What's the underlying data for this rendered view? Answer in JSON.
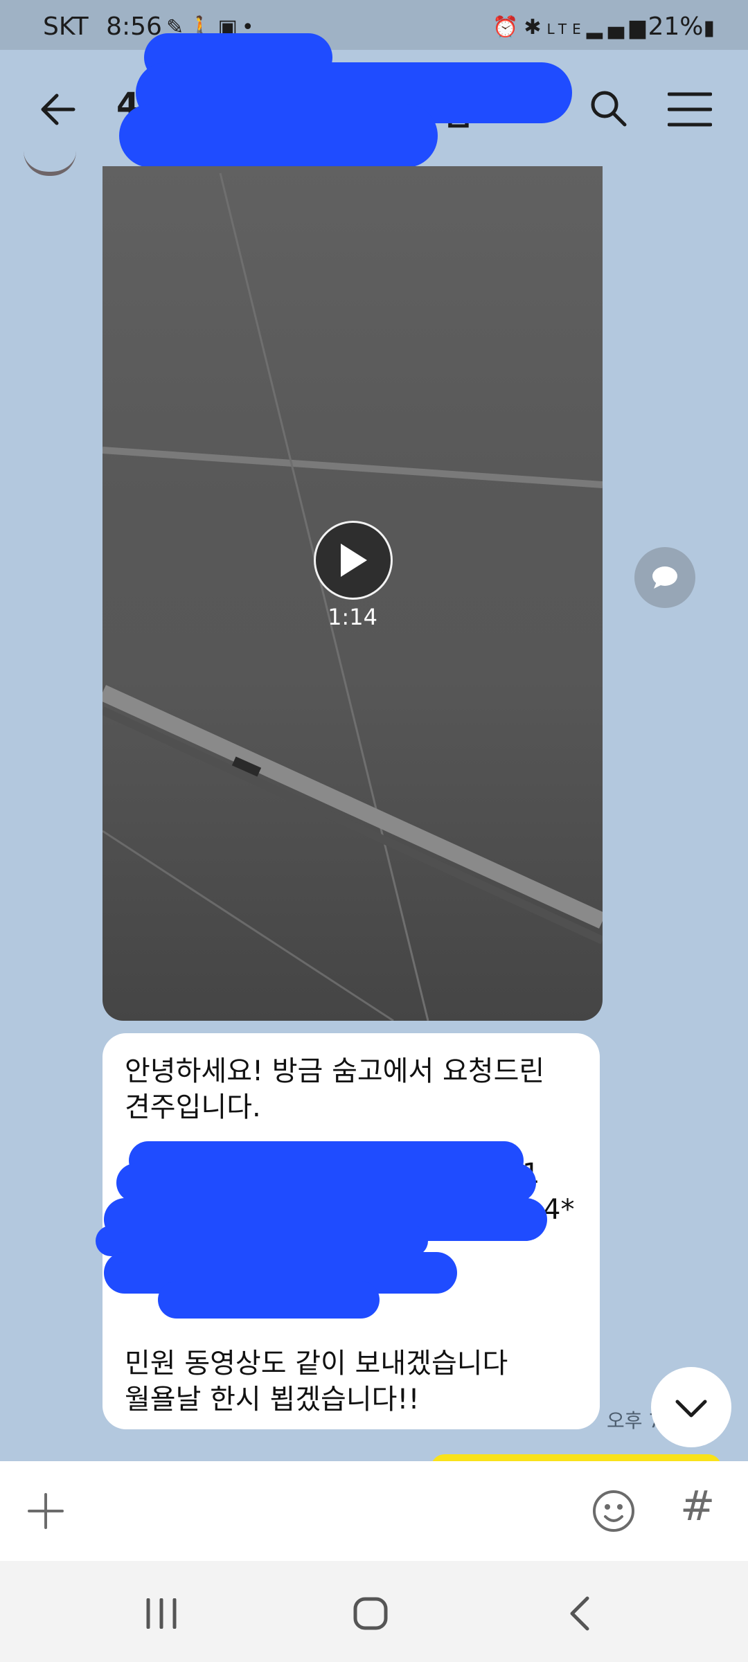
{
  "status_bar": {
    "carrier": "SKT",
    "time": "8:56",
    "left_icons": [
      "navigation-icon",
      "walk-icon",
      "gallery-icon",
      "dot-icon"
    ],
    "right_icons": [
      "alarm-icon",
      "bluetooth-icon",
      "lte-icon",
      "signal-icon"
    ],
    "battery": "21%"
  },
  "header": {
    "title_visible": "4",
    "title_suffix_visible": "님",
    "title_redacted": true
  },
  "video_message": {
    "duration": "1:14"
  },
  "text_message": {
    "lines": [
      "안녕하세요! 방금 숨고에서 요청드린",
      "견주입니다.",
      "",
      "",
      "",
      "",
      "민원 동영상도 같이 보내겠습니다",
      "월욜날 한시 뵙겠습니다!!"
    ],
    "partial_visible_right": [
      "1",
      "4*"
    ],
    "time_partial": "오후 7"
  },
  "input_bar": {
    "hash_label": "#"
  },
  "colors": {
    "chat_bg": "#b3c8de",
    "status_bg": "#9fb2c5",
    "redaction": "#1f4cff",
    "my_bubble": "#f9e21a"
  }
}
